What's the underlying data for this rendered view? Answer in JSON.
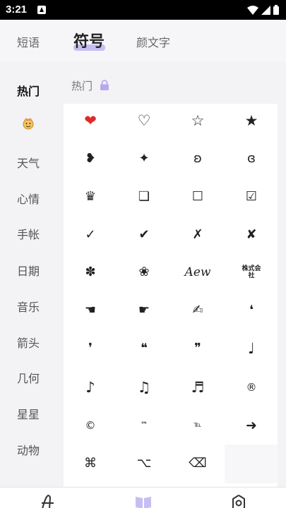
{
  "status_bar": {
    "time": "3:21"
  },
  "tabs": [
    {
      "label": "短语",
      "active": false
    },
    {
      "label": "符号",
      "active": true
    },
    {
      "label": "颜文字",
      "active": false
    }
  ],
  "sidebar": {
    "items": [
      {
        "label": "热门",
        "active": true
      },
      {
        "label": "",
        "icon": "emoji-face-icon",
        "active": false
      },
      {
        "label": "天气",
        "active": false
      },
      {
        "label": "心情",
        "active": false
      },
      {
        "label": "手帐",
        "active": false
      },
      {
        "label": "日期",
        "active": false
      },
      {
        "label": "音乐",
        "active": false
      },
      {
        "label": "箭头",
        "active": false
      },
      {
        "label": "几何",
        "active": false
      },
      {
        "label": "星星",
        "active": false
      },
      {
        "label": "动物",
        "active": false
      }
    ]
  },
  "section": {
    "title": "热门"
  },
  "symbols": [
    [
      "❤",
      "♡",
      "☆",
      "★"
    ],
    [
      "❥",
      "✦",
      "ʚ",
      "ɞ"
    ],
    [
      "♛",
      "❏",
      "☐",
      "☑"
    ],
    [
      "✓",
      "✔",
      "✗",
      "✘"
    ],
    [
      "✽",
      "❀",
      "Aew",
      "株式会社"
    ],
    [
      "☚",
      "☛",
      "✍",
      "❛"
    ],
    [
      "❜",
      "❝",
      "❞",
      "♩"
    ],
    [
      "♪",
      "♫",
      "♬",
      "®"
    ],
    [
      "©",
      "™",
      "℡",
      "➜"
    ],
    [
      "⌘",
      "⌥",
      "⌫",
      ""
    ]
  ],
  "colors": {
    "accent": "#c8bdf3",
    "lock": "#b9a9ec",
    "heart": "#e02a2a"
  }
}
